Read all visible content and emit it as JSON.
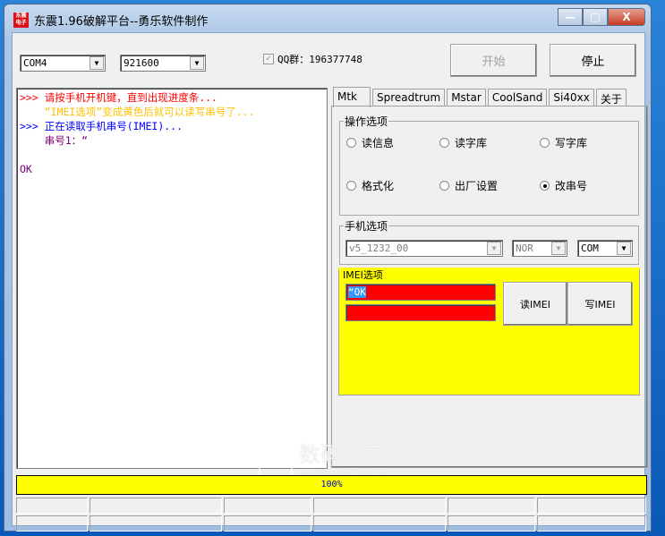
{
  "window": {
    "title": "东震1.96破解平台--勇乐软件制作",
    "logo_text": "东震电子",
    "minimize": "—",
    "maximize": "□",
    "close": "X"
  },
  "toolbar": {
    "port": "COM4",
    "baud": "921600",
    "qq_checked": true,
    "qq_label": "QQ群：196377748",
    "start_label": "开始",
    "stop_label": "停止"
  },
  "log": [
    {
      "prefix": ">>> ",
      "text": "请按手机开机键，直到出现进度条...",
      "color": "#ff0000"
    },
    {
      "prefix": "    ",
      "text": "“IMEI选项”变成黄色后就可以读写串号了...",
      "color": "#ffc000"
    },
    {
      "prefix": ">>> ",
      "text": "正在读取手机串号(IMEI)...",
      "color": "#0000ff"
    },
    {
      "prefix": "    ",
      "text": "串号1：“",
      "color": "#800080"
    },
    {
      "prefix": "",
      "text": "",
      "color": "#000"
    },
    {
      "prefix": "",
      "text": "OK",
      "color": "#800080"
    }
  ],
  "tabs": [
    "Mtk",
    "Spreadtrum",
    "Mstar",
    "CoolSand",
    "Si40xx",
    "关于"
  ],
  "ops": {
    "label": "操作选项",
    "options": [
      "读信息",
      "读字库",
      "写字库",
      "格式化",
      "出厂设置",
      "改串号"
    ],
    "selected": "改串号"
  },
  "phone": {
    "label": "手机选项",
    "model": "v5_1232_00",
    "flash": "NOR",
    "conn": "COM"
  },
  "imei": {
    "label": "IMEI选项",
    "imei1": "“OK",
    "imei2": "",
    "read_label": "读IMEI",
    "write_label": "写IMEI",
    "bg": "#ffff00",
    "field_bg": "#ff0000"
  },
  "progress": {
    "value": 100,
    "label": "100%"
  },
  "watermark": {
    "cn": "数码之家",
    "en": "MYDIGIT.NET"
  }
}
